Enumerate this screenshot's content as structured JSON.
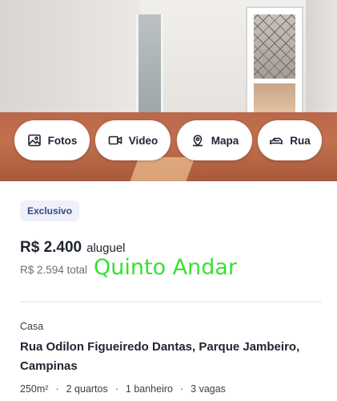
{
  "media_buttons": {
    "fotos": {
      "label": "Fotos",
      "icon": "image-icon"
    },
    "video": {
      "label": "Video",
      "icon": "video-camera-icon"
    },
    "mapa": {
      "label": "Mapa",
      "icon": "map-pin-icon"
    },
    "rua": {
      "label": "Rua",
      "icon": "street-view-icon"
    }
  },
  "listing": {
    "badge": "Exclusivo",
    "price_value": "R$ 2.400",
    "price_suffix": "aluguel",
    "total": "R$ 2.594 total",
    "property_type": "Casa",
    "address": "Rua Odilon Figueiredo Dantas, Parque Jambeiro, Campinas",
    "features": {
      "area": "250m²",
      "bedrooms": "2 quartos",
      "bathrooms": "1 banheiro",
      "parking": "3 vagas",
      "separator": "·"
    }
  },
  "watermark": "Quinto Andar",
  "colors": {
    "badge_bg": "#eef1fb",
    "badge_text": "#3a4a7a",
    "watermark": "#35e32f",
    "text_primary": "#1f2430",
    "text_secondary": "#6b6f7a"
  }
}
